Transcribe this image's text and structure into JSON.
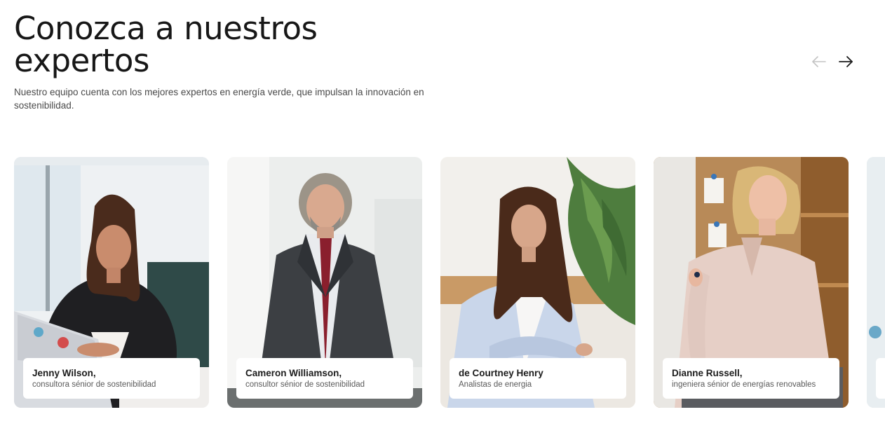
{
  "section": {
    "title": "Conozca a nuestros expertos",
    "subtitle": "Nuestro equipo cuenta con los mejores expertos en energía verde, que impulsan la innovación en sostenibilidad."
  },
  "navigation": {
    "prev_icon": "arrow-left-icon",
    "next_icon": "arrow-right-icon",
    "prev_color": "#c4c4c4",
    "next_color": "#1a1a1a"
  },
  "experts": [
    {
      "name": "Jenny Wilson,",
      "role": "consultora sénior de sostenibilidad"
    },
    {
      "name": "Cameron Williamson,",
      "role": "consultor sénior de sostenibilidad"
    },
    {
      "name": "de Courtney Henry",
      "role": "Analistas de energia"
    },
    {
      "name": "Dianne Russell,",
      "role": "ingeniera sénior de energías renovables"
    }
  ]
}
